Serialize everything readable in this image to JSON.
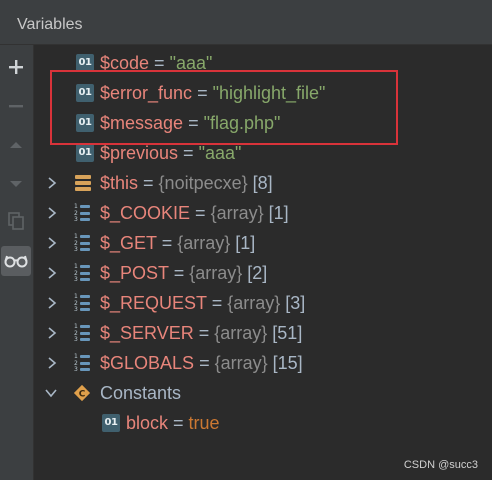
{
  "panel": {
    "title": "Variables"
  },
  "toolbar": {
    "buttons": [
      {
        "name": "add-watch-button",
        "icon": "plus-icon"
      },
      {
        "name": "remove-watch-button",
        "icon": "minus-icon"
      },
      {
        "name": "move-up-button",
        "icon": "arrow-up-icon"
      },
      {
        "name": "move-down-button",
        "icon": "arrow-down-icon"
      },
      {
        "name": "copy-button",
        "icon": "copy-icon"
      },
      {
        "name": "view-watches-button",
        "icon": "glasses-icon"
      }
    ]
  },
  "variables": [
    {
      "name": "$code",
      "eq": " = ",
      "value": "\"aaa\"",
      "value_kind": "string",
      "icon": "field-01-icon",
      "expandable": false
    },
    {
      "name": "$error_func",
      "eq": " = ",
      "value": "\"highlight_file\"",
      "value_kind": "string",
      "icon": "field-01-icon",
      "expandable": false
    },
    {
      "name": "$message",
      "eq": " = ",
      "value": "\"flag.php\"",
      "value_kind": "string",
      "icon": "field-01-icon",
      "expandable": false
    },
    {
      "name": "$previous",
      "eq": " = ",
      "value": "\"aaa\"",
      "value_kind": "string",
      "icon": "field-01-icon",
      "expandable": false
    },
    {
      "name": "$this",
      "eq": " = ",
      "type": "{noitpecxe}",
      "count": "[8]",
      "icon": "object-icon",
      "expandable": true
    },
    {
      "name": "$_COOKIE",
      "eq": " = ",
      "type": "{array}",
      "count": "[1]",
      "icon": "array-icon",
      "expandable": true
    },
    {
      "name": "$_GET",
      "eq": " = ",
      "type": "{array}",
      "count": "[1]",
      "icon": "array-icon",
      "expandable": true
    },
    {
      "name": "$_POST",
      "eq": " = ",
      "type": "{array}",
      "count": "[2]",
      "icon": "array-icon",
      "expandable": true
    },
    {
      "name": "$_REQUEST",
      "eq": " = ",
      "type": "{array}",
      "count": "[3]",
      "icon": "array-icon",
      "expandable": true
    },
    {
      "name": "$_SERVER",
      "eq": " = ",
      "type": "{array}",
      "count": "[51]",
      "icon": "array-icon",
      "expandable": true
    },
    {
      "name": "$GLOBALS",
      "eq": " = ",
      "type": "{array}",
      "count": "[15]",
      "icon": "array-icon",
      "expandable": true
    }
  ],
  "constants": {
    "label": "Constants",
    "icon": "constants-class-icon",
    "expanded": true,
    "items": [
      {
        "name": "block",
        "eq": " = ",
        "value": "true",
        "icon": "field-01-icon"
      }
    ]
  },
  "watermark": "CSDN @succ3",
  "colors": {
    "background": "#2b2b2b",
    "variable_name": "#e8857b",
    "string_value": "#6a8759",
    "keyword": "#cc7832",
    "highlight_border": "#d9333a"
  }
}
